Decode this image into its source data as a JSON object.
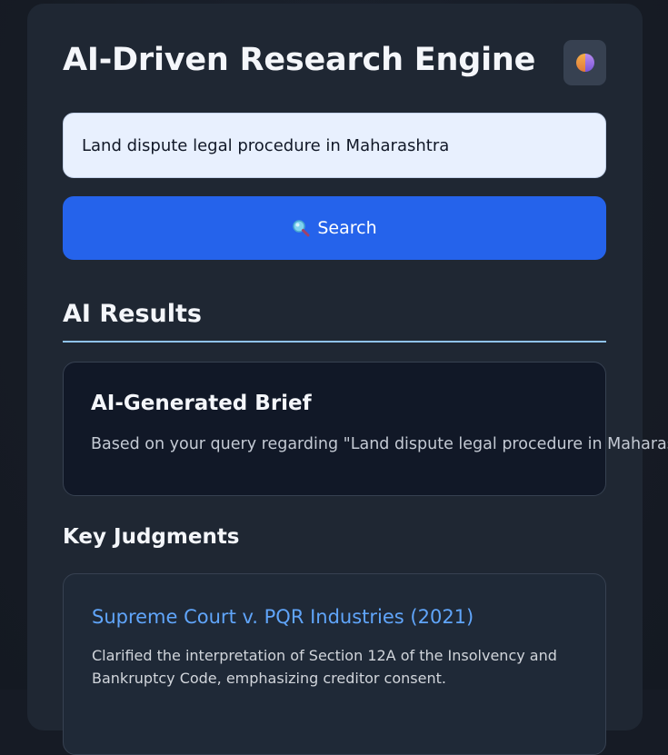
{
  "header": {
    "title": "AI-Driven Research Engine",
    "theme_toggle_icon": "half-circle-theme-icon"
  },
  "search": {
    "value": "Land dispute legal procedure in Maharashtra",
    "placeholder": "",
    "button_label": "Search",
    "button_icon": "magnifier-icon"
  },
  "results": {
    "heading": "AI Results",
    "brief": {
      "title": "AI-Generated Brief",
      "text": "Based on your query regarding \"Land dispute legal procedure in Maharashtra\""
    }
  },
  "judgments": {
    "heading": "Key Judgments",
    "items": [
      {
        "title": "Supreme Court v. PQR Industries (2021)",
        "summary": "Clarified the interpretation of Section 12A of the Insolvency and Bankruptcy Code, emphasizing creditor consent."
      }
    ]
  },
  "colors": {
    "background": "#161b25",
    "panel": "#1f2733",
    "accent": "#2563eb",
    "link": "#60a5fa",
    "divider": "#8fc3ee",
    "input_bg": "#e8f0fe"
  }
}
